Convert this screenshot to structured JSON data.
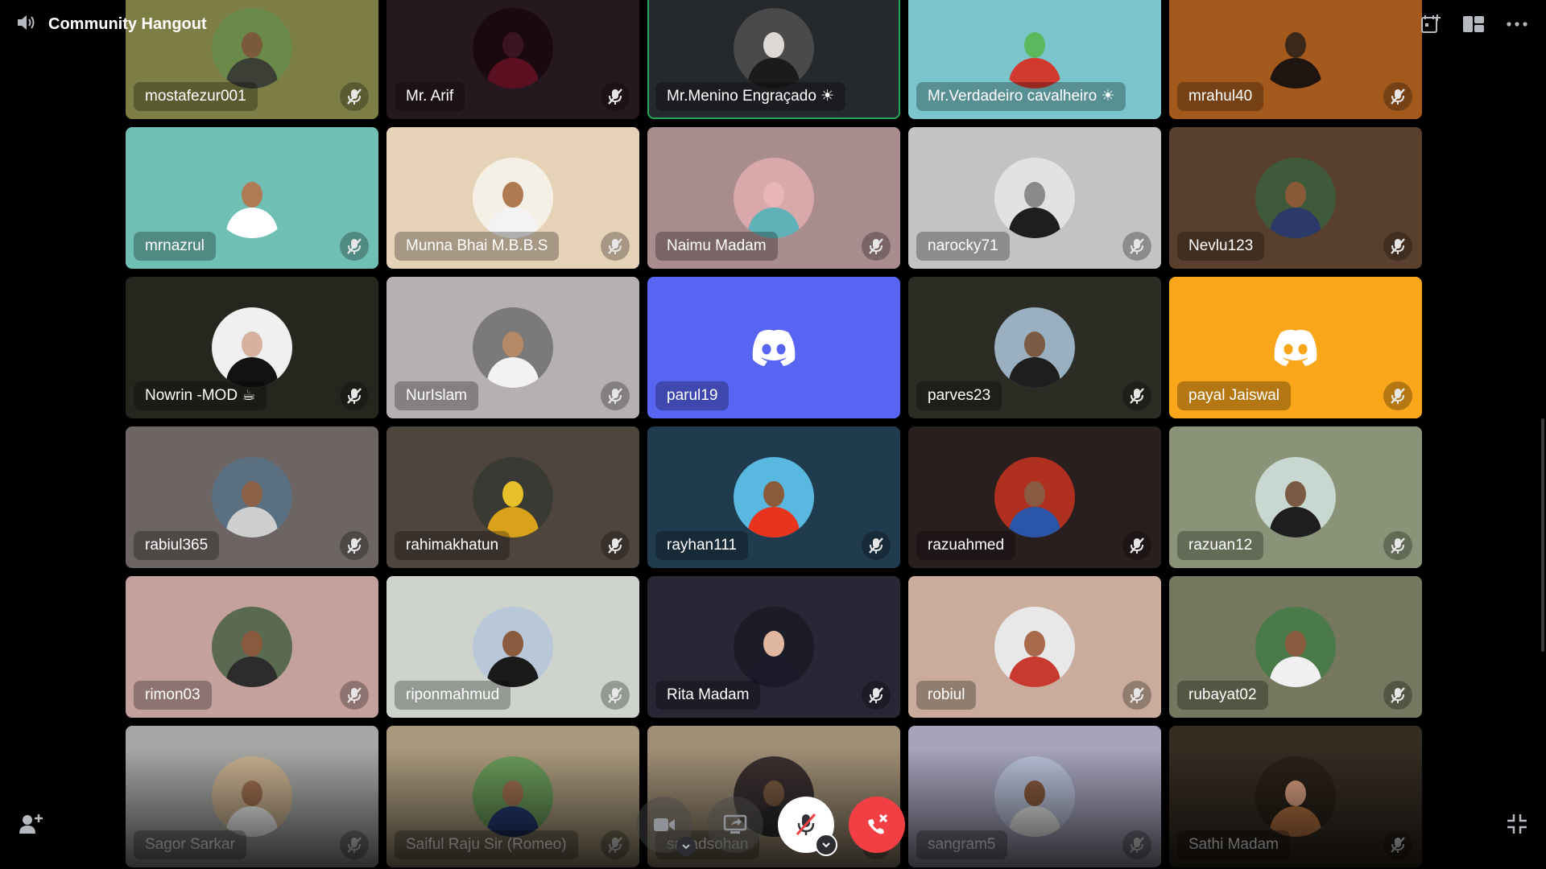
{
  "header": {
    "title": "Community Hangout",
    "speaker_icon": "speaker-icon",
    "actions": [
      "add-activity-icon",
      "layout-icon",
      "more-icon"
    ]
  },
  "colors": {
    "speaking": "#23a55a",
    "hangup": "#f23f43",
    "blurple": "#5865f2",
    "orange": "#faa61a"
  },
  "participants": [
    {
      "name": "mostafezur001",
      "bg": "#7d7e45",
      "skin": "#7a5a3a",
      "shirt": "#3c3f35",
      "avbg": "#6a8a4a",
      "muted": true
    },
    {
      "name": "Mr. Arif",
      "bg": "#26181f",
      "skin": "#3a1520",
      "shirt": "#5a1020",
      "avbg": "#1a0a10",
      "muted": true
    },
    {
      "name": "Mr.Menino Engraçado ☀",
      "bg": "#25282c",
      "skin": "#ddd8d4",
      "shirt": "#1b1b1b",
      "avbg": "#4a4a4a",
      "muted": false,
      "speaking": true
    },
    {
      "name": "Mr.Verdadeiro cavalheiro ☀",
      "bg": "#7ac6cc",
      "skin": "#5cb85c",
      "shirt": "#d33a2f",
      "avbg": "#7ac6cc",
      "muted": false
    },
    {
      "name": "mrahul40",
      "bg": "#a45a1c",
      "skin": "#3b2818",
      "shirt": "#1f1510",
      "avbg": "#a45a1c",
      "muted": true
    },
    {
      "name": "mrnazrul",
      "bg": "#6fbfb4",
      "skin": "#b07a55",
      "shirt": "#ffffff",
      "avbg": "#6fbfb4",
      "muted": true
    },
    {
      "name": "Munna Bhai M.B.B.S",
      "bg": "#e6d3b7",
      "skin": "#b07a50",
      "shirt": "#f3f3f3",
      "avbg": "#f5f0e6",
      "muted": true
    },
    {
      "name": "Naimu Madam",
      "bg": "#a98d8e",
      "skin": "#e8b5b8",
      "shirt": "#5fb2b8",
      "avbg": "#d8a8aa",
      "muted": true
    },
    {
      "name": "narocky71",
      "bg": "#c3c3c3",
      "skin": "#8a8a8a",
      "shirt": "#1e1e1e",
      "avbg": "#e2e2e2",
      "muted": true
    },
    {
      "name": "Nevlu123",
      "bg": "#59402e",
      "skin": "#8a5a38",
      "shirt": "#2b3a68",
      "avbg": "#3e5a3a",
      "muted": true
    },
    {
      "name": "Nowrin -MOD ☕",
      "bg": "#25271f",
      "skin": "#d8b0a0",
      "shirt": "#121212",
      "avbg": "#f0f0f0",
      "muted": true
    },
    {
      "name": "NurIslam",
      "bg": "#b7b0b3",
      "skin": "#b58a68",
      "shirt": "#f2f2f2",
      "avbg": "#7a7a7a",
      "muted": true
    },
    {
      "name": "parul19",
      "bg": "#5865f2",
      "logo": true,
      "muted": false
    },
    {
      "name": "parves23",
      "bg": "#2b2c24",
      "skin": "#7a5a42",
      "shirt": "#1e1e1e",
      "avbg": "#9ab0c0",
      "muted": true
    },
    {
      "name": "payal Jaiswal",
      "bg": "#faa61a",
      "logo": true,
      "muted": true
    },
    {
      "name": "rabiul365",
      "bg": "#6d6563",
      "skin": "#8a6046",
      "shirt": "#cfcfcf",
      "avbg": "#5a7080",
      "muted": true
    },
    {
      "name": "rahimakhatun",
      "bg": "#4e453c",
      "skin": "#e8c02a",
      "shirt": "#d9a21a",
      "avbg": "#3a3a34",
      "muted": true
    },
    {
      "name": "rayhan111",
      "bg": "#1f3b4d",
      "skin": "#8a5a3a",
      "shirt": "#e8341c",
      "avbg": "#58b8e0",
      "muted": true
    },
    {
      "name": "razuahmed",
      "bg": "#2a1f1f",
      "skin": "#8a5a42",
      "shirt": "#2a55a8",
      "avbg": "#b03020",
      "muted": true
    },
    {
      "name": "razuan12",
      "bg": "#8a9378",
      "skin": "#7a5a42",
      "shirt": "#1e1e1e",
      "avbg": "#c8d8d0",
      "muted": true
    },
    {
      "name": "rimon03",
      "bg": "#c4a19c",
      "skin": "#8a5a3e",
      "shirt": "#2c2c2c",
      "avbg": "#5a6a50",
      "muted": true
    },
    {
      "name": "riponmahmud",
      "bg": "#ced4cc",
      "skin": "#8a5a3e",
      "shirt": "#1a1a1a",
      "avbg": "#b8c8d8",
      "muted": true
    },
    {
      "name": "Rita Madam",
      "bg": "#272735",
      "skin": "#e0b8a0",
      "shirt": "#1a1a2a",
      "avbg": "#1c1c28",
      "muted": true
    },
    {
      "name": "robiul",
      "bg": "#c9ac9c",
      "skin": "#a86a4a",
      "shirt": "#c83a30",
      "avbg": "#e8e8e8",
      "muted": true
    },
    {
      "name": "rubayat02",
      "bg": "#75785e",
      "skin": "#8a5a3e",
      "shirt": "#f0f0f0",
      "avbg": "#4a7a4a",
      "muted": true
    },
    {
      "name": "Sagor Sarkar",
      "bg": "#a6a7a5",
      "skin": "#a07050",
      "shirt": "#f0f0f0",
      "avbg": "#c8b090",
      "muted": true
    },
    {
      "name": "Saiful Raju Sir (Romeo)",
      "bg": "#a9997c",
      "skin": "#a07050",
      "shirt": "#243a70",
      "avbg": "#6a9a5a",
      "muted": true
    },
    {
      "name": "sajjadsohan",
      "bg": "#9f8e75",
      "skin": "#7a5a42",
      "shirt": "#2a2a2a",
      "avbg": "#3a3030",
      "muted": true
    },
    {
      "name": "sangram5",
      "bg": "#a5a4bb",
      "skin": "#8a5a3e",
      "shirt": "#e8e8e8",
      "avbg": "#b8c0d8",
      "muted": true
    },
    {
      "name": "Sathi Madam",
      "bg": "#352c22",
      "skin": "#d8a080",
      "shirt": "#b07040",
      "avbg": "#2a2018",
      "muted": true
    }
  ],
  "controls": {
    "camera_icon": "camera-icon",
    "screen_share_icon": "screen-share-icon",
    "mic_icon": "mic-muted-icon",
    "hangup_icon": "hangup-icon"
  },
  "corners": {
    "invite_icon": "add-user-icon",
    "fullscreen_icon": "exit-fullscreen-icon"
  }
}
